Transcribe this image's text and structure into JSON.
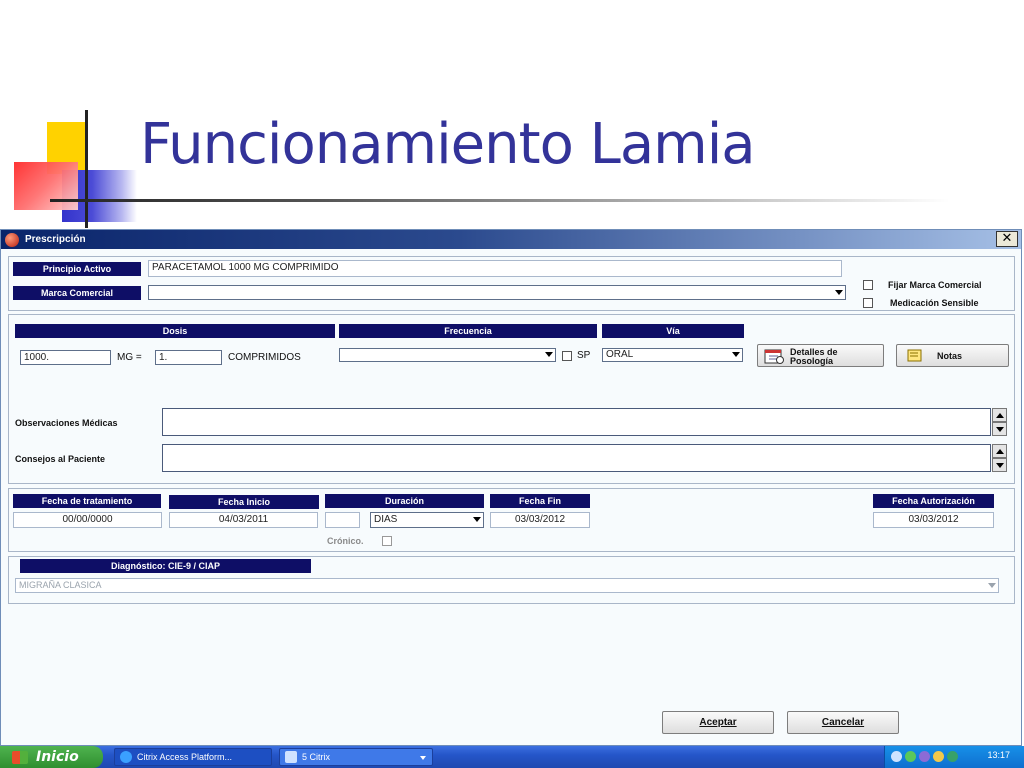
{
  "slide": {
    "title": "Funcionamiento Lamia"
  },
  "window": {
    "title": "Prescripción",
    "close_label": "✕"
  },
  "medication": {
    "principio_activo_label": "Principio Activo",
    "principio_activo_value": "PARACETAMOL 1000 MG COMPRIMIDO",
    "marca_comercial_label": "Marca Comercial",
    "marca_comercial_value": "",
    "fijar_marca_label": "Fijar Marca Comercial",
    "medicacion_sensible_label": "Medicación Sensible"
  },
  "dosing": {
    "dosis_label": "Dosis",
    "frecuencia_label": "Frecuencia",
    "via_label": "Vía",
    "dose_value": "1000.",
    "unit": "MG =",
    "quantity_value": "1.",
    "form": "COMPRIMIDOS",
    "frecuencia_value": "",
    "sp_label": "SP",
    "via_value": "ORAL",
    "detalles_label_line1": "Detalles de",
    "detalles_label_line2": "Posología",
    "notas_label": "Notas",
    "observaciones_label": "Observaciones Médicas",
    "consejos_label": "Consejos al Paciente"
  },
  "dates": {
    "fecha_tratamiento_label": "Fecha de tratamiento",
    "fecha_tratamiento_value": "00/00/0000",
    "fecha_inicio_label": "Fecha Inicio",
    "fecha_inicio_value": "04/03/2011",
    "duracion_label": "Duración",
    "duracion_value": "",
    "duracion_unit": "DIAS",
    "fecha_fin_label": "Fecha Fin",
    "fecha_fin_value": "03/03/2012",
    "fecha_autorizacion_label": "Fecha Autorización",
    "fecha_autorizacion_value": "03/03/2012",
    "cronico_label": "Crónico."
  },
  "diagnosis": {
    "label": "Diagnóstico: CIE-9 / CIAP",
    "value": "MIGRAÑA CLASICA"
  },
  "actions": {
    "aceptar_label": "Aceptar",
    "cancelar_label": "Cancelar"
  },
  "taskbar": {
    "start_label": "Inicio",
    "item1_label": "Citrix Access Platform...",
    "item2_label": "5 Citrix",
    "clock": "13:17"
  }
}
